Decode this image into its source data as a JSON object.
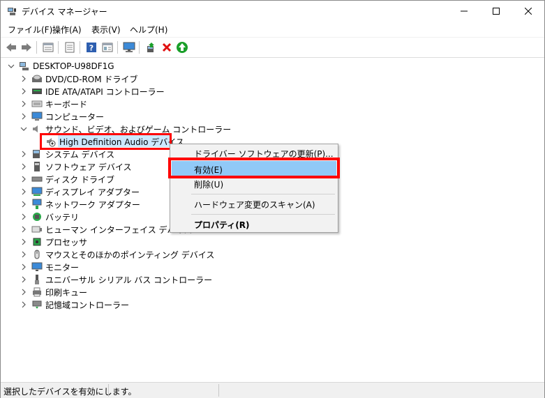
{
  "window": {
    "title": "デバイス マネージャー",
    "controls": {
      "minimize": "—",
      "maximize": "☐",
      "close": "✕"
    }
  },
  "menu": [
    {
      "label": "ファイル(F)"
    },
    {
      "label": "操作(A)"
    },
    {
      "label": "表示(V)"
    },
    {
      "label": "ヘルプ(H)"
    }
  ],
  "toolbar": [
    {
      "icon": "back-arrow-icon"
    },
    {
      "icon": "forward-arrow-icon"
    },
    {
      "icon": "properties-icon"
    },
    {
      "icon": "print-icon"
    },
    {
      "icon": "help-icon"
    },
    {
      "icon": "show-hide-icon"
    },
    {
      "icon": "monitor-icon"
    },
    {
      "icon": "update-driver-icon"
    },
    {
      "icon": "uninstall-icon"
    },
    {
      "icon": "enable-icon"
    }
  ],
  "tree": {
    "root": "DESKTOP-U98DF1G",
    "items": [
      {
        "label": "DVD/CD-ROM ドライブ",
        "icon": "disc-drive-icon",
        "expanded": false
      },
      {
        "label": "IDE ATA/ATAPI コントローラー",
        "icon": "ide-controller-icon",
        "expanded": false
      },
      {
        "label": "キーボード",
        "icon": "keyboard-icon",
        "expanded": false
      },
      {
        "label": "コンピューター",
        "icon": "computer-icon",
        "expanded": false
      },
      {
        "label": "サウンド、ビデオ、およびゲーム コントローラー",
        "icon": "speaker-icon",
        "expanded": true,
        "children": [
          {
            "label": "High Definition Audio デバイス",
            "icon": "audio-device-disabled-icon"
          }
        ]
      },
      {
        "label": "システム デバイス",
        "icon": "system-devices-icon",
        "expanded": false
      },
      {
        "label": "ソフトウェア デバイス",
        "icon": "software-device-icon",
        "expanded": false
      },
      {
        "label": "ディスク ドライブ",
        "icon": "disk-drive-icon",
        "expanded": false
      },
      {
        "label": "ディスプレイ アダプター",
        "icon": "display-adapter-icon",
        "expanded": false
      },
      {
        "label": "ネットワーク アダプター",
        "icon": "network-adapter-icon",
        "expanded": false
      },
      {
        "label": "バッテリ",
        "icon": "battery-icon",
        "expanded": false
      },
      {
        "label": "ヒューマン インターフェイス デバイス",
        "icon": "hid-icon",
        "expanded": false
      },
      {
        "label": "プロセッサ",
        "icon": "processor-icon",
        "expanded": false
      },
      {
        "label": "マウスとそのほかのポインティング デバイス",
        "icon": "mouse-icon",
        "expanded": false
      },
      {
        "label": "モニター",
        "icon": "monitor-icon",
        "expanded": false
      },
      {
        "label": "ユニバーサル シリアル バス コントローラー",
        "icon": "usb-icon",
        "expanded": false
      },
      {
        "label": "印刷キュー",
        "icon": "print-queue-icon",
        "expanded": false
      },
      {
        "label": "記憶域コントローラー",
        "icon": "storage-controller-icon",
        "expanded": false
      }
    ]
  },
  "context_menu": {
    "items": [
      {
        "label": "ドライバー ソフトウェアの更新(P)...",
        "bold": false
      },
      {
        "label": "有効(E)",
        "bold": false,
        "highlighted": true
      },
      {
        "label": "削除(U)",
        "bold": false
      },
      {
        "label": "ハードウェア変更のスキャン(A)",
        "bold": false
      },
      {
        "label": "プロパティ(R)",
        "bold": true
      }
    ]
  },
  "status": {
    "text": "選択したデバイスを有効にします。"
  },
  "colors": {
    "selection": "#cce8ff",
    "menu_hover": "#91c9f7",
    "annotation_red": "#ff0000",
    "enable_green": "#1a9f29",
    "uninstall_red": "#e01010"
  }
}
